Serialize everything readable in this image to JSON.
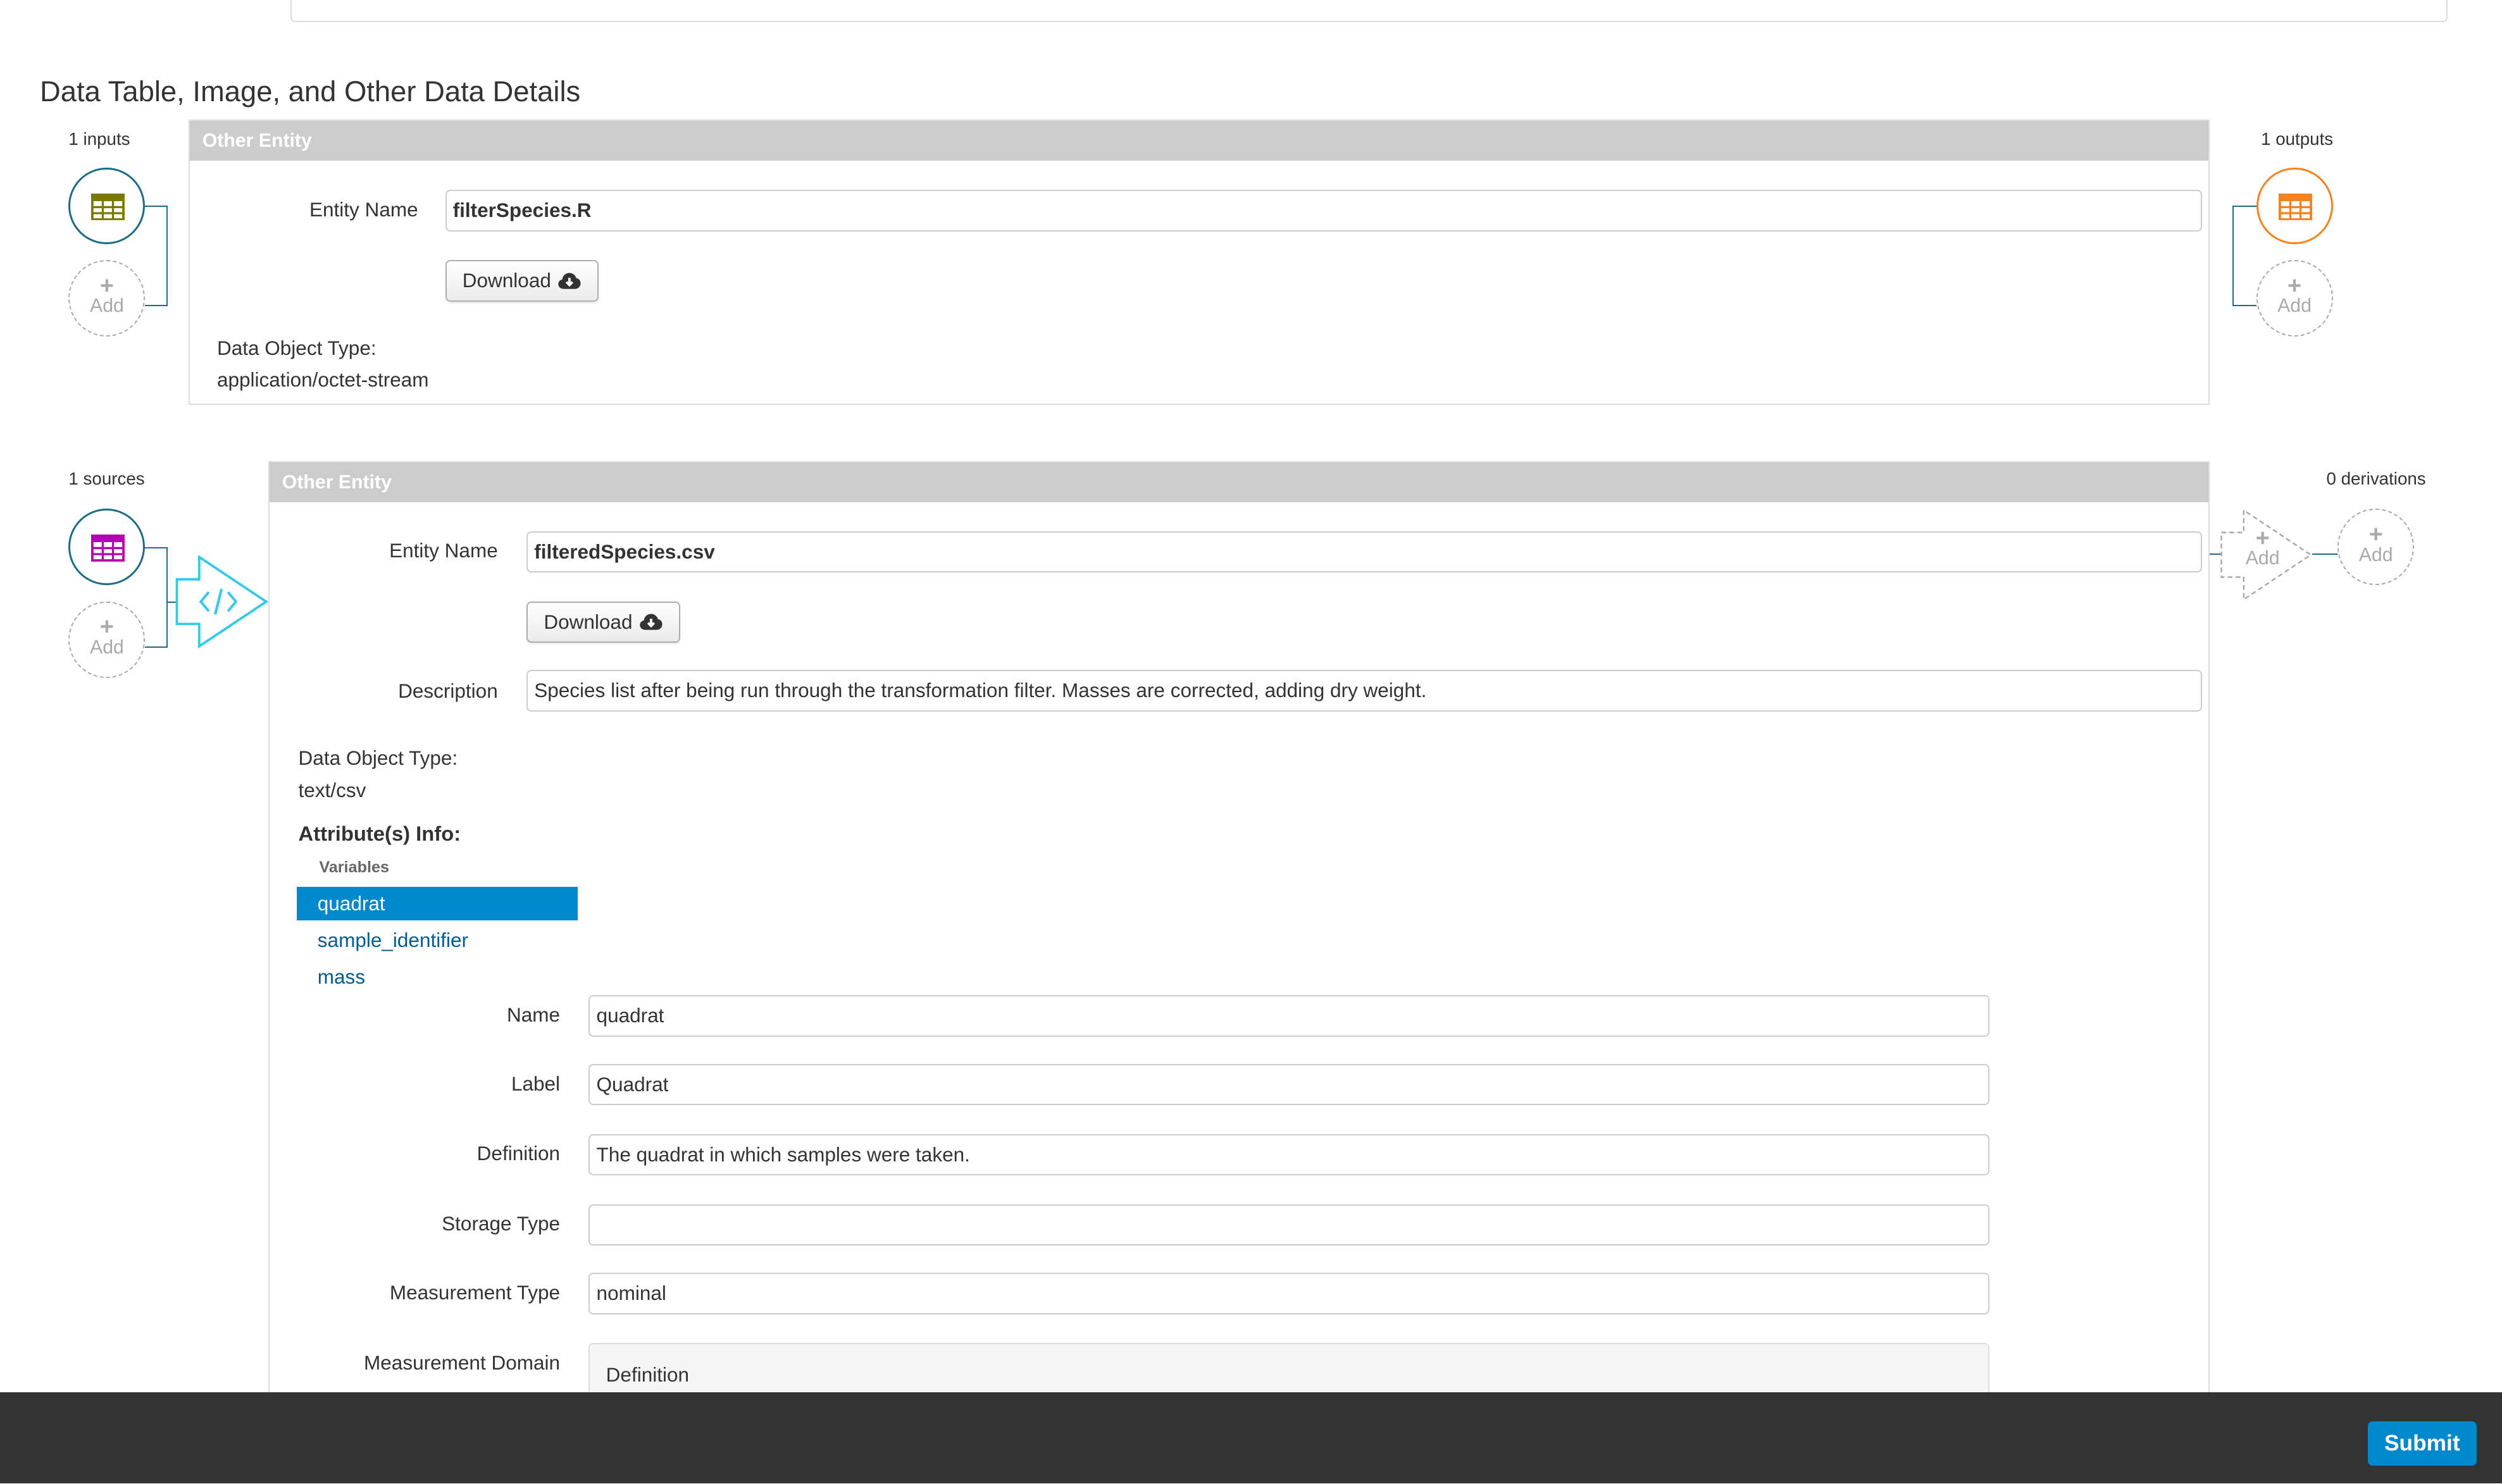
{
  "section": {
    "title": "Data Table, Image, and Other Data Details"
  },
  "entity1": {
    "header": "Other Entity",
    "inputs_label": "1 inputs",
    "outputs_label": "1 outputs",
    "add_label": "Add",
    "entity_name_label": "Entity Name",
    "entity_name_value": "filterSpecies.R",
    "download_label": "Download",
    "data_object_type_label": "Data Object Type:",
    "data_object_type_value": "application/octet-stream",
    "icon_colors": {
      "input": "#7a7a00",
      "output": "#f5821f"
    }
  },
  "entity2": {
    "header": "Other Entity",
    "sources_label": "1 sources",
    "derivations_label": "0 derivations",
    "add_label": "Add",
    "entity_name_label": "Entity Name",
    "entity_name_value": "filteredSpecies.csv",
    "download_label": "Download",
    "description_label": "Description",
    "description_value": "Species list after being run through the transformation filter. Masses are corrected, adding dry weight.",
    "data_object_type_label": "Data Object Type:",
    "data_object_type_value": "text/csv",
    "attributes_heading": "Attribute(s) Info:",
    "variables_heading": "Variables",
    "variables": [
      {
        "label": "quadrat",
        "active": true
      },
      {
        "label": "sample_identifier",
        "active": false
      },
      {
        "label": "mass",
        "active": false
      }
    ],
    "attribute_form": {
      "name_label": "Name",
      "name_value": "quadrat",
      "label_label": "Label",
      "label_value": "Quadrat",
      "definition_label": "Definition",
      "definition_value": "The quadrat in which samples were taken.",
      "storage_type_label": "Storage Type",
      "storage_type_value": "",
      "measurement_type_label": "Measurement Type",
      "measurement_type_value": "nominal",
      "measurement_domain_label": "Measurement Domain",
      "measurement_domain_inner": "Definition"
    },
    "icon_colors": {
      "source": "#b300b3",
      "program": "#33c9e8"
    }
  },
  "footer": {
    "submit_label": "Submit"
  },
  "colors": {
    "accent": "#0088cc",
    "teal": "#1d6b84",
    "header_gray": "#cccccc",
    "footer": "#333333"
  }
}
